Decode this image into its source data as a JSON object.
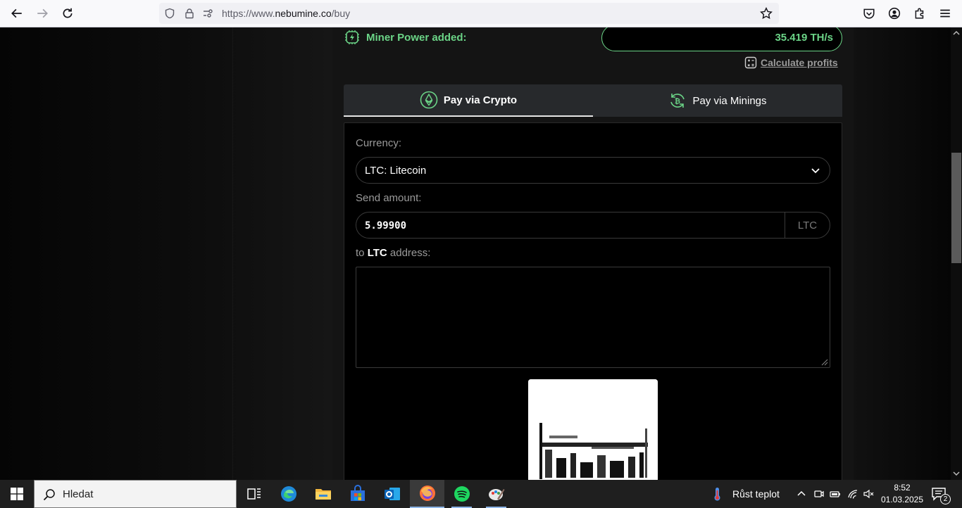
{
  "browser": {
    "url_prefix": "https://www.",
    "url_domain": "nebumine.co",
    "url_path": "/buy"
  },
  "miner": {
    "label": "Miner Power added:",
    "value": "35.419 TH/s",
    "calc_link": "Calculate profits"
  },
  "tabs": [
    {
      "label": "Pay via Crypto",
      "active": true
    },
    {
      "label": "Pay via Minings",
      "active": false
    }
  ],
  "form": {
    "currency_label": "Currency:",
    "currency_value": "LTC: Litecoin",
    "amount_label": "Send amount:",
    "amount_value": "5.99900",
    "amount_unit": "LTC",
    "address_label_prefix": "to ",
    "address_label_coin": "LTC",
    "address_label_suffix": " address:",
    "address_value": ""
  },
  "taskbar": {
    "search_placeholder": "Hledat",
    "weather_text": "Růst teplot",
    "time": "8:52",
    "date": "01.03.2025",
    "notification_count": "2",
    "apps": [
      "task-view-icon",
      "edge-icon",
      "file-explorer-icon",
      "store-icon",
      "outlook-icon",
      "firefox-icon",
      "spotify-icon",
      "paint-icon"
    ]
  },
  "colors": {
    "accent_green": "#6bd487",
    "panel_bg": "#141414",
    "tab_bg": "#27292c"
  }
}
